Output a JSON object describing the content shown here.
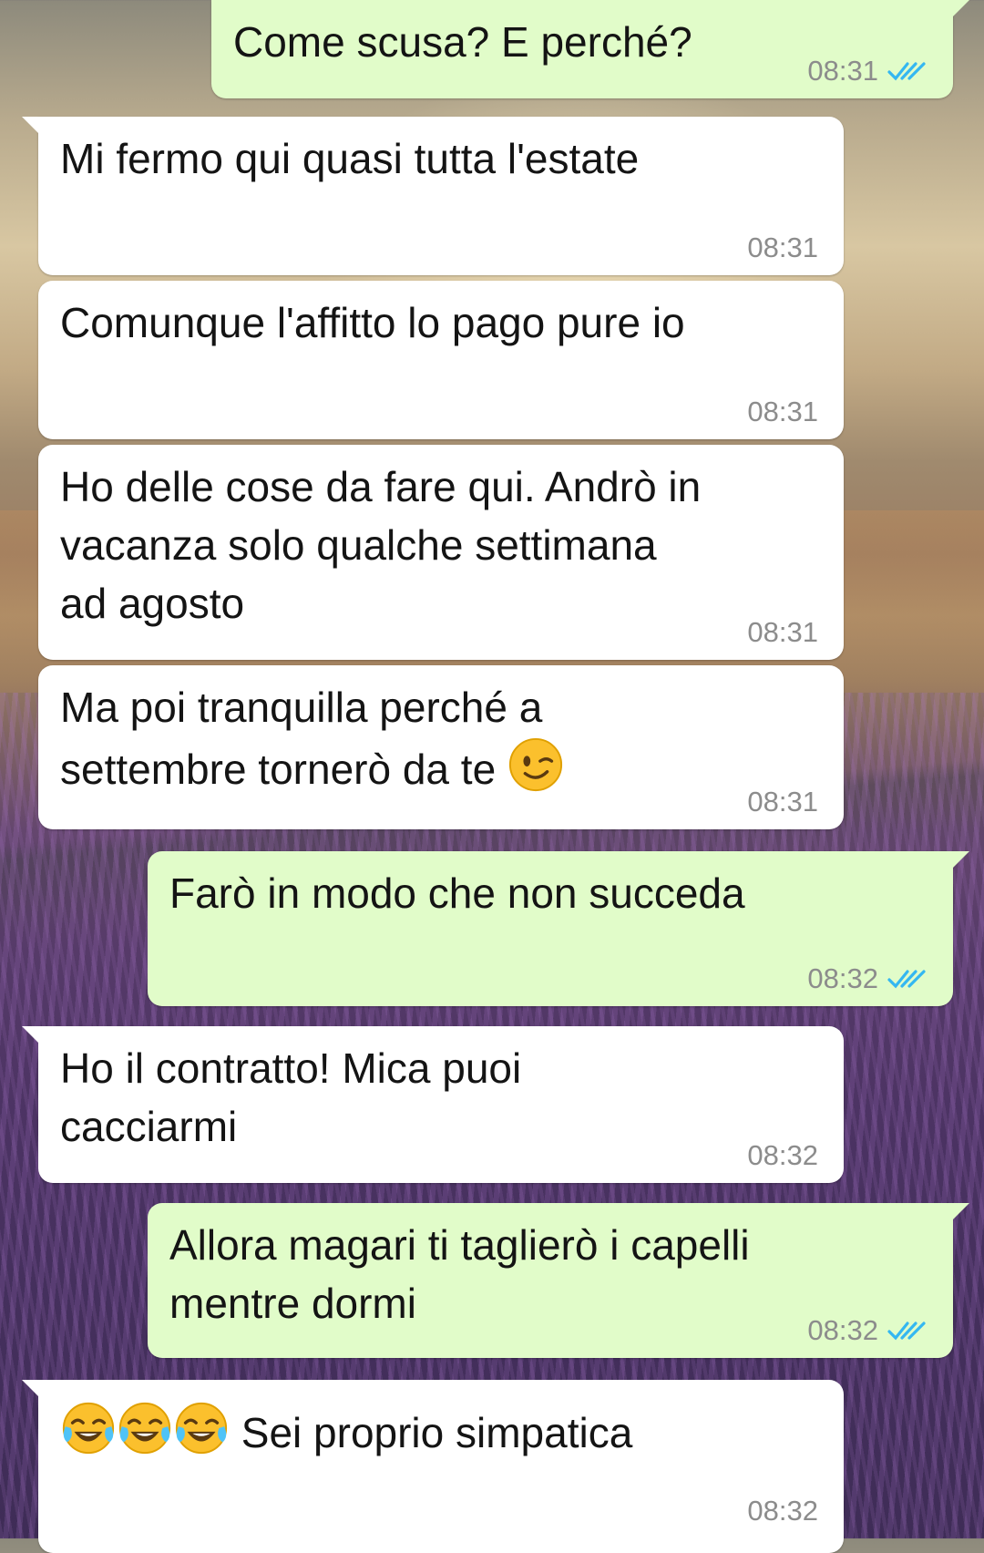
{
  "chat": {
    "messages": [
      {
        "direction": "outgoing",
        "text": "Come scusa? E perché?",
        "time": "08:31",
        "status": "read"
      },
      {
        "direction": "incoming",
        "text": "Mi fermo qui quasi tutta l'estate",
        "time": "08:31"
      },
      {
        "direction": "incoming",
        "text": "Comunque l'affitto lo pago pure io",
        "time": "08:31"
      },
      {
        "direction": "incoming",
        "text": "Ho delle cose da fare qui. Andrò in\nvacanza solo qualche settimana\nad agosto",
        "time": "08:31"
      },
      {
        "direction": "incoming",
        "text": "Ma poi tranquilla perché a\nsettembre tornerò da te",
        "emoji": "winking-face",
        "time": "08:31"
      },
      {
        "direction": "outgoing",
        "text": "Farò in modo che non succeda",
        "time": "08:32",
        "status": "read"
      },
      {
        "direction": "incoming",
        "text": "Ho il contratto! Mica puoi\ncacciarmi",
        "time": "08:32"
      },
      {
        "direction": "outgoing",
        "text": "Allora magari ti taglierò i capelli\nmentre dormi",
        "time": "08:32",
        "status": "read"
      },
      {
        "direction": "incoming",
        "text": "Sei proprio simpatica",
        "emoji_prefix": [
          "face-with-tears-of-joy",
          "face-with-tears-of-joy",
          "face-with-tears-of-joy"
        ],
        "time": "08:32"
      }
    ]
  },
  "colors": {
    "incoming_bubble": "#ffffff",
    "outgoing_bubble": "#e1fcc9",
    "read_ticks": "#34b7f1",
    "timestamp": "#8c8c8c"
  }
}
